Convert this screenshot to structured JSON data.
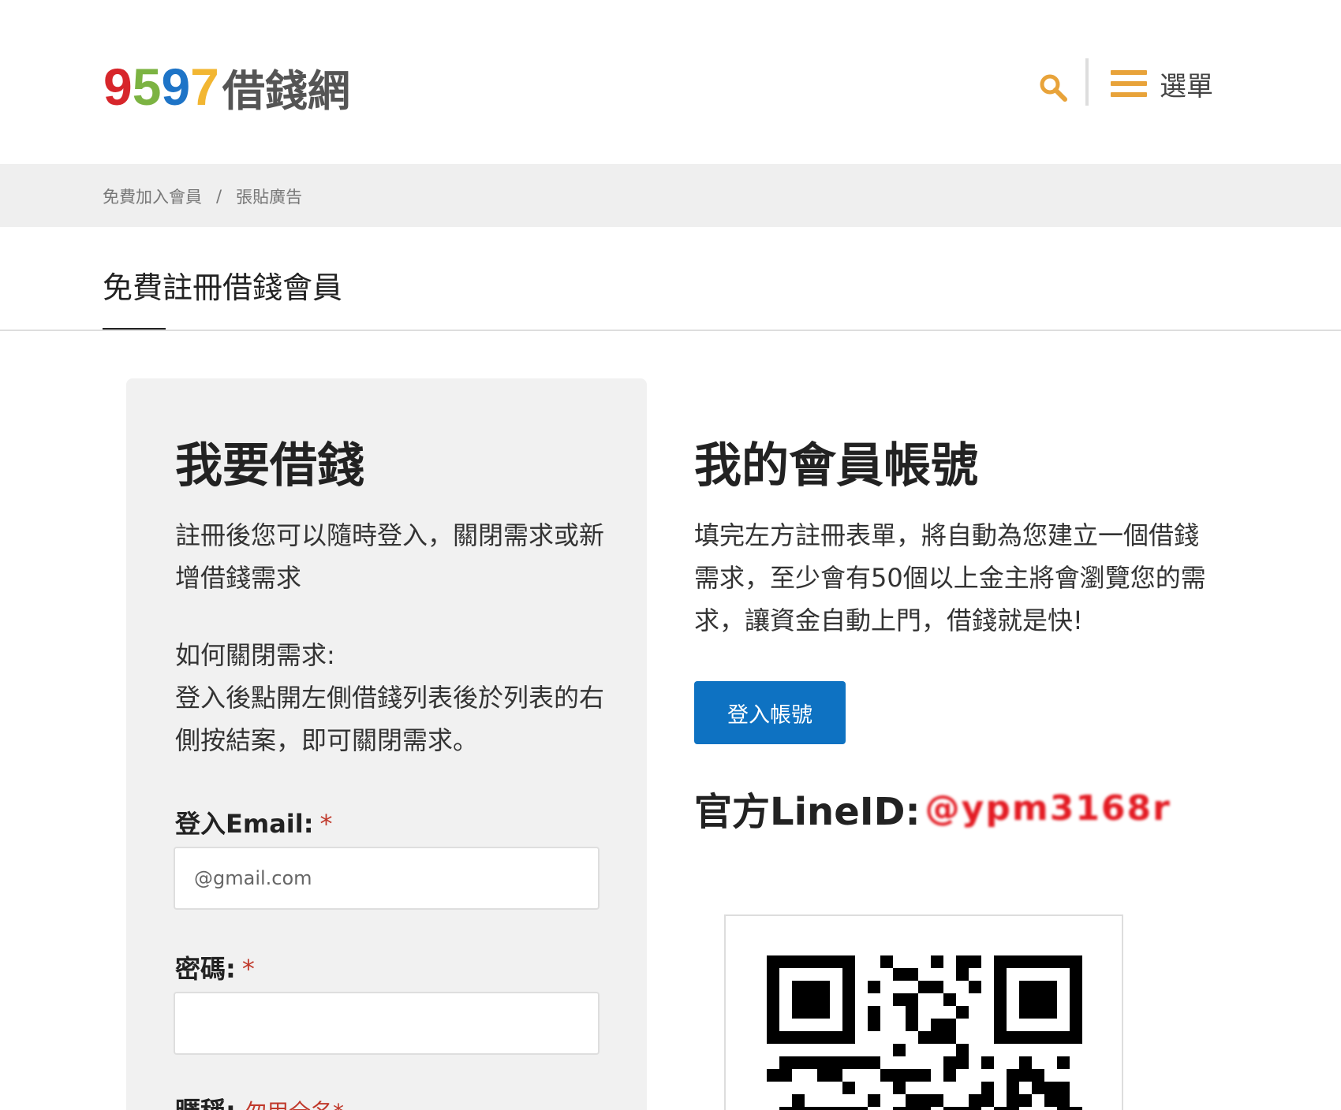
{
  "header": {
    "logo": {
      "digits": [
        "9",
        "5",
        "9",
        "7"
      ],
      "digit_colors": [
        "#d7262b",
        "#7cb342",
        "#1e74c7",
        "#f2b632"
      ],
      "name": "借錢網"
    },
    "search_icon": "search-icon",
    "menu_icon": "hamburger-icon",
    "menu_label": "選單",
    "accent": "#e8a33a"
  },
  "breadcrumb": {
    "items": [
      "免費加入會員",
      "張貼廣告"
    ],
    "separator": "/"
  },
  "page": {
    "title": "免費註冊借錢會員"
  },
  "borrow": {
    "title": "我要借錢",
    "intro": "註冊後您可以隨時登入，關閉需求或新增借錢需求",
    "howto_title": "如何關閉需求:",
    "howto_text": "登入後點開左側借錢列表後於列表的右側按結案，即可關閉需求。",
    "form": {
      "email_label": "登入Email:",
      "email_placeholder": "@gmail.com",
      "password_label": "密碼:",
      "nickname_label": "暱稱:",
      "nickname_note": "勿用全名*",
      "required_mark": "*"
    }
  },
  "account": {
    "title": "我的會員帳號",
    "text": "填完左方註冊表單，將自動為您建立一個借錢需求，至少會有50個以上金主將會瀏覽您的需求，讓資金自動上門，借錢就是快!",
    "login_button": "登入帳號",
    "button_color": "#0e72c2",
    "line_label": "官方LineID:",
    "line_id": "@ypm3168r"
  }
}
